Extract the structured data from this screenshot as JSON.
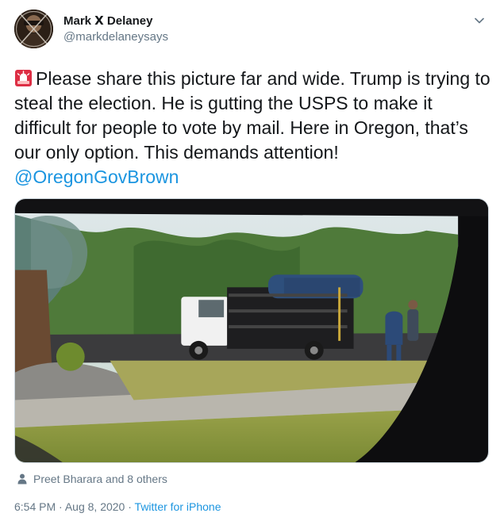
{
  "user": {
    "display_name": "Mark Ⅹ Delaney",
    "handle": "@markdelaneysays",
    "avatar_icon": "profile-photo"
  },
  "tweet": {
    "emoji_icon": "rotating-light-icon",
    "text": "Please share this picture far and wide. Trump is trying to steal the election. He is gutting the USPS to make it difficult for people to vote by mail. Here in Oregon, that’s our only option. This demands attention!",
    "mention": "@OregonGovBrown"
  },
  "media": {
    "kind": "photo",
    "subject": "flatbed truck loaded with USPS mailboxes"
  },
  "social_context": {
    "icon": "person-icon",
    "text": "Preet Bharara and 8 others"
  },
  "meta": {
    "time": "6:54 PM",
    "separator": "·",
    "date": "Aug 8, 2020",
    "source": "Twitter for iPhone"
  },
  "colors": {
    "link": "#1b95e0",
    "secondary_text": "#657786",
    "primary_text": "#14171a"
  }
}
